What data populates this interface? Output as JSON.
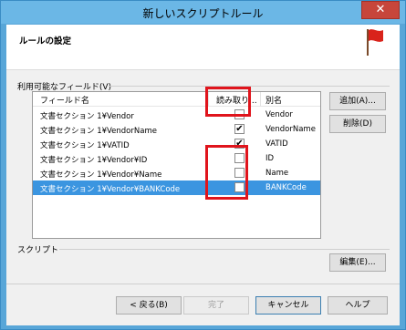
{
  "window": {
    "title": "新しいスクリプトルール",
    "close_label": "✕"
  },
  "header": {
    "title": "ルールの設定",
    "icon": "red-flag-icon"
  },
  "fields_section": {
    "label": "利用可能なフィールド(V)"
  },
  "listview": {
    "columns": [
      "フィールド名",
      "読み取り...",
      "別名"
    ],
    "rows": [
      {
        "name": "文書セクション 1¥Vendor",
        "checked": false,
        "alias": "Vendor"
      },
      {
        "name": "文書セクション 1¥VendorName",
        "checked": true,
        "alias": "VendorName"
      },
      {
        "name": "文書セクション 1¥VATID",
        "checked": true,
        "alias": "VATID"
      },
      {
        "name": "文書セクション 1¥Vendor¥ID",
        "checked": false,
        "alias": "ID"
      },
      {
        "name": "文書セクション 1¥Vendor¥Name",
        "checked": false,
        "alias": "Name"
      },
      {
        "name": "文書セクション 1¥Vendor¥BANKCode",
        "checked": false,
        "alias": "BANKCode",
        "selected": true
      }
    ]
  },
  "side_buttons": {
    "add": "追加(A)...",
    "delete": "削除(D)"
  },
  "script_section": {
    "label": "スクリプト",
    "edit": "編集(E)..."
  },
  "footer": {
    "back": "< 戻る(B)",
    "finish": "完了",
    "cancel": "キャンセル",
    "help": "ヘルプ"
  },
  "colors": {
    "selection": "#3b95e0",
    "highlight": "#e0141c",
    "titlebar": "#6bb7e6"
  }
}
